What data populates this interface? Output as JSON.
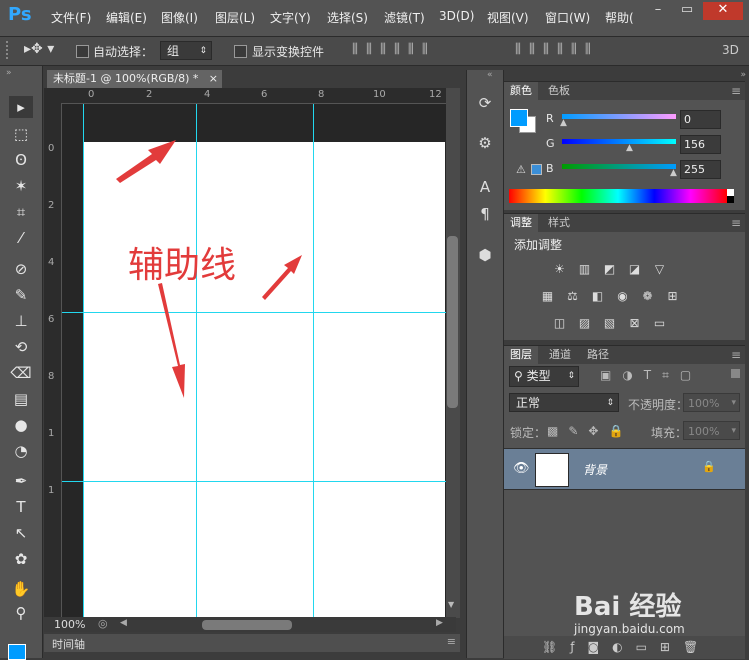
{
  "app": {
    "logo": "Ps"
  },
  "menu": [
    "文件(F)",
    "编辑(E)",
    "图像(I)",
    "图层(L)",
    "文字(Y)",
    "选择(S)",
    "滤镜(T)",
    "3D(D)",
    "视图(V)",
    "窗口(W)",
    "帮助("
  ],
  "options_bar": {
    "auto_select_label": "自动选择：",
    "auto_select_value": "组",
    "show_transform_label": "显示变换控件",
    "mode_label": "3D"
  },
  "document": {
    "tab_title": "未标题-1 @ 100%(RGB/8) *",
    "close_glyph": "×",
    "zoom": "100%",
    "ruler_h": [
      "0",
      "2",
      "4",
      "6",
      "8",
      "10",
      "12"
    ],
    "ruler_v": [
      "0",
      "2",
      "4",
      "6",
      "8",
      "1",
      "1"
    ],
    "annotation": "辅助线"
  },
  "timeline": {
    "label": "时间轴"
  },
  "color_panel": {
    "tab_active": "颜色",
    "tab_other": "色板",
    "channels": [
      {
        "name": "R",
        "value": "0"
      },
      {
        "name": "G",
        "value": "156"
      },
      {
        "name": "B",
        "value": "255"
      }
    ],
    "foreground_color": "#009cff",
    "background_color": "#ffffff"
  },
  "adjustments_panel": {
    "tab_active": "调整",
    "tab_other": "样式",
    "title": "添加调整"
  },
  "layers_panel": {
    "tab_active": "图层",
    "tab_channels": "通道",
    "tab_paths": "路径",
    "filter_label": "类型",
    "blend_mode": "正常",
    "opacity_label": "不透明度：",
    "opacity_value": "100%",
    "lock_label": "锁定：",
    "fill_label": "填充：",
    "fill_value": "100%",
    "layers": [
      {
        "name": "背景",
        "visible": true,
        "locked": true
      }
    ]
  },
  "watermark": {
    "text": "Bai 经验",
    "url": "jingyan.baidu.com"
  },
  "colors": {
    "guide": "#22d7ee",
    "annotation_red": "#e23b3b",
    "selected_layer": "#6a7f96"
  }
}
